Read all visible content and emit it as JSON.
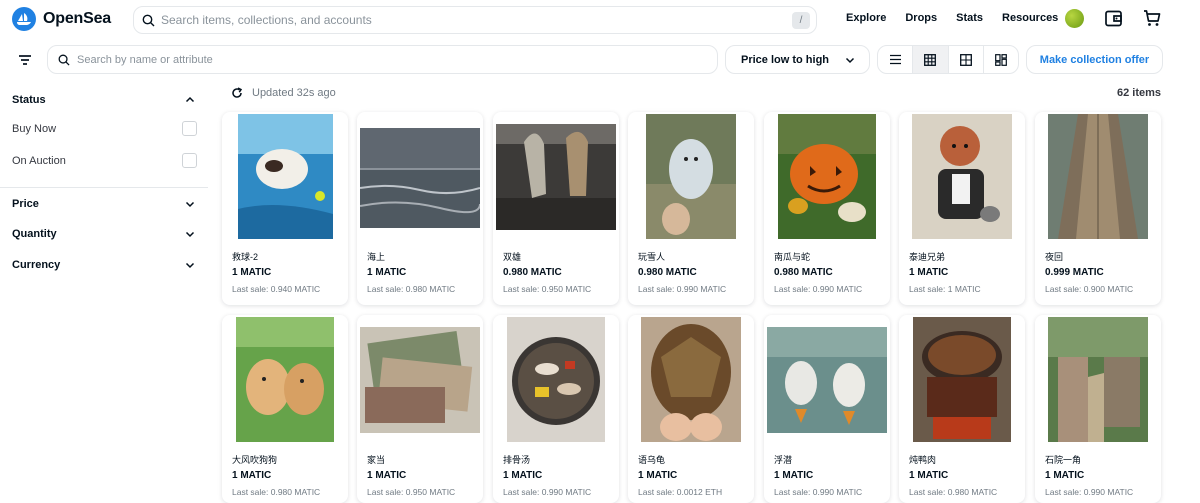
{
  "brand": {
    "name": "OpenSea",
    "color": "#2081e2"
  },
  "global_search": {
    "placeholder": "Search items, collections, and accounts",
    "shortcut": "/"
  },
  "nav": {
    "links": [
      "Explore",
      "Drops",
      "Stats",
      "Resources"
    ],
    "icons": [
      "avatar",
      "wallet-icon",
      "cart-icon"
    ]
  },
  "toolbar": {
    "filter_icon": "filter-icon",
    "trait_search_placeholder": "Search by name or attribute",
    "sort_label": "Price low to high",
    "view_modes": [
      "list-view-icon",
      "grid-view-icon",
      "large-grid-view-icon",
      "masonry-view-icon"
    ],
    "active_view": "grid-view-icon",
    "offer_button": "Make collection offer"
  },
  "sidebar": {
    "status": {
      "label": "Status",
      "options": [
        "Buy Now",
        "On Auction"
      ]
    },
    "sections": [
      "Price",
      "Quantity",
      "Currency"
    ]
  },
  "results": {
    "updated": "Updated 32s ago",
    "count": "62 items"
  },
  "items": [
    {
      "name": "救球-2",
      "price": "1 MATIC",
      "last_sale": "Last sale: 0.940 MATIC",
      "scene": "dog-pool"
    },
    {
      "name": "海上",
      "price": "1 MATIC",
      "last_sale": "Last sale: 0.980 MATIC",
      "scene": "sea"
    },
    {
      "name": "双雄",
      "price": "0.980 MATIC",
      "last_sale": "Last sale: 0.950 MATIC",
      "scene": "two-horses"
    },
    {
      "name": "玩雪人",
      "price": "0.980 MATIC",
      "last_sale": "Last sale: 0.990 MATIC",
      "scene": "snowman"
    },
    {
      "name": "南瓜与蛇",
      "price": "0.980 MATIC",
      "last_sale": "Last sale: 0.990 MATIC",
      "scene": "pumpkin"
    },
    {
      "name": "泰迪兄弟",
      "price": "1 MATIC",
      "last_sale": "Last sale: 1 MATIC",
      "scene": "teddy"
    },
    {
      "name": "夜回",
      "price": "0.999 MATIC",
      "last_sale": "Last sale: 0.900 MATIC",
      "scene": "pier"
    },
    {
      "name": "大风吹狗狗",
      "price": "1 MATIC",
      "last_sale": "Last sale: 0.980 MATIC",
      "scene": "puppies"
    },
    {
      "name": "家当",
      "price": "1 MATIC",
      "last_sale": "Last sale: 0.950 MATIC",
      "scene": "money"
    },
    {
      "name": "排骨汤",
      "price": "1 MATIC",
      "last_sale": "Last sale: 0.990 MATIC",
      "scene": "soup"
    },
    {
      "name": "语乌龟",
      "price": "1 MATIC",
      "last_sale": "Last sale: 0.0012 ETH",
      "scene": "turtle"
    },
    {
      "name": "浮潜",
      "price": "1 MATIC",
      "last_sale": "Last sale: 0.990 MATIC",
      "scene": "ducks"
    },
    {
      "name": "炖鸭肉",
      "price": "1 MATIC",
      "last_sale": "Last sale: 0.980 MATIC",
      "scene": "pot"
    },
    {
      "name": "石院一角",
      "price": "1 MATIC",
      "last_sale": "Last sale: 0.990 MATIC",
      "scene": "garden"
    }
  ]
}
